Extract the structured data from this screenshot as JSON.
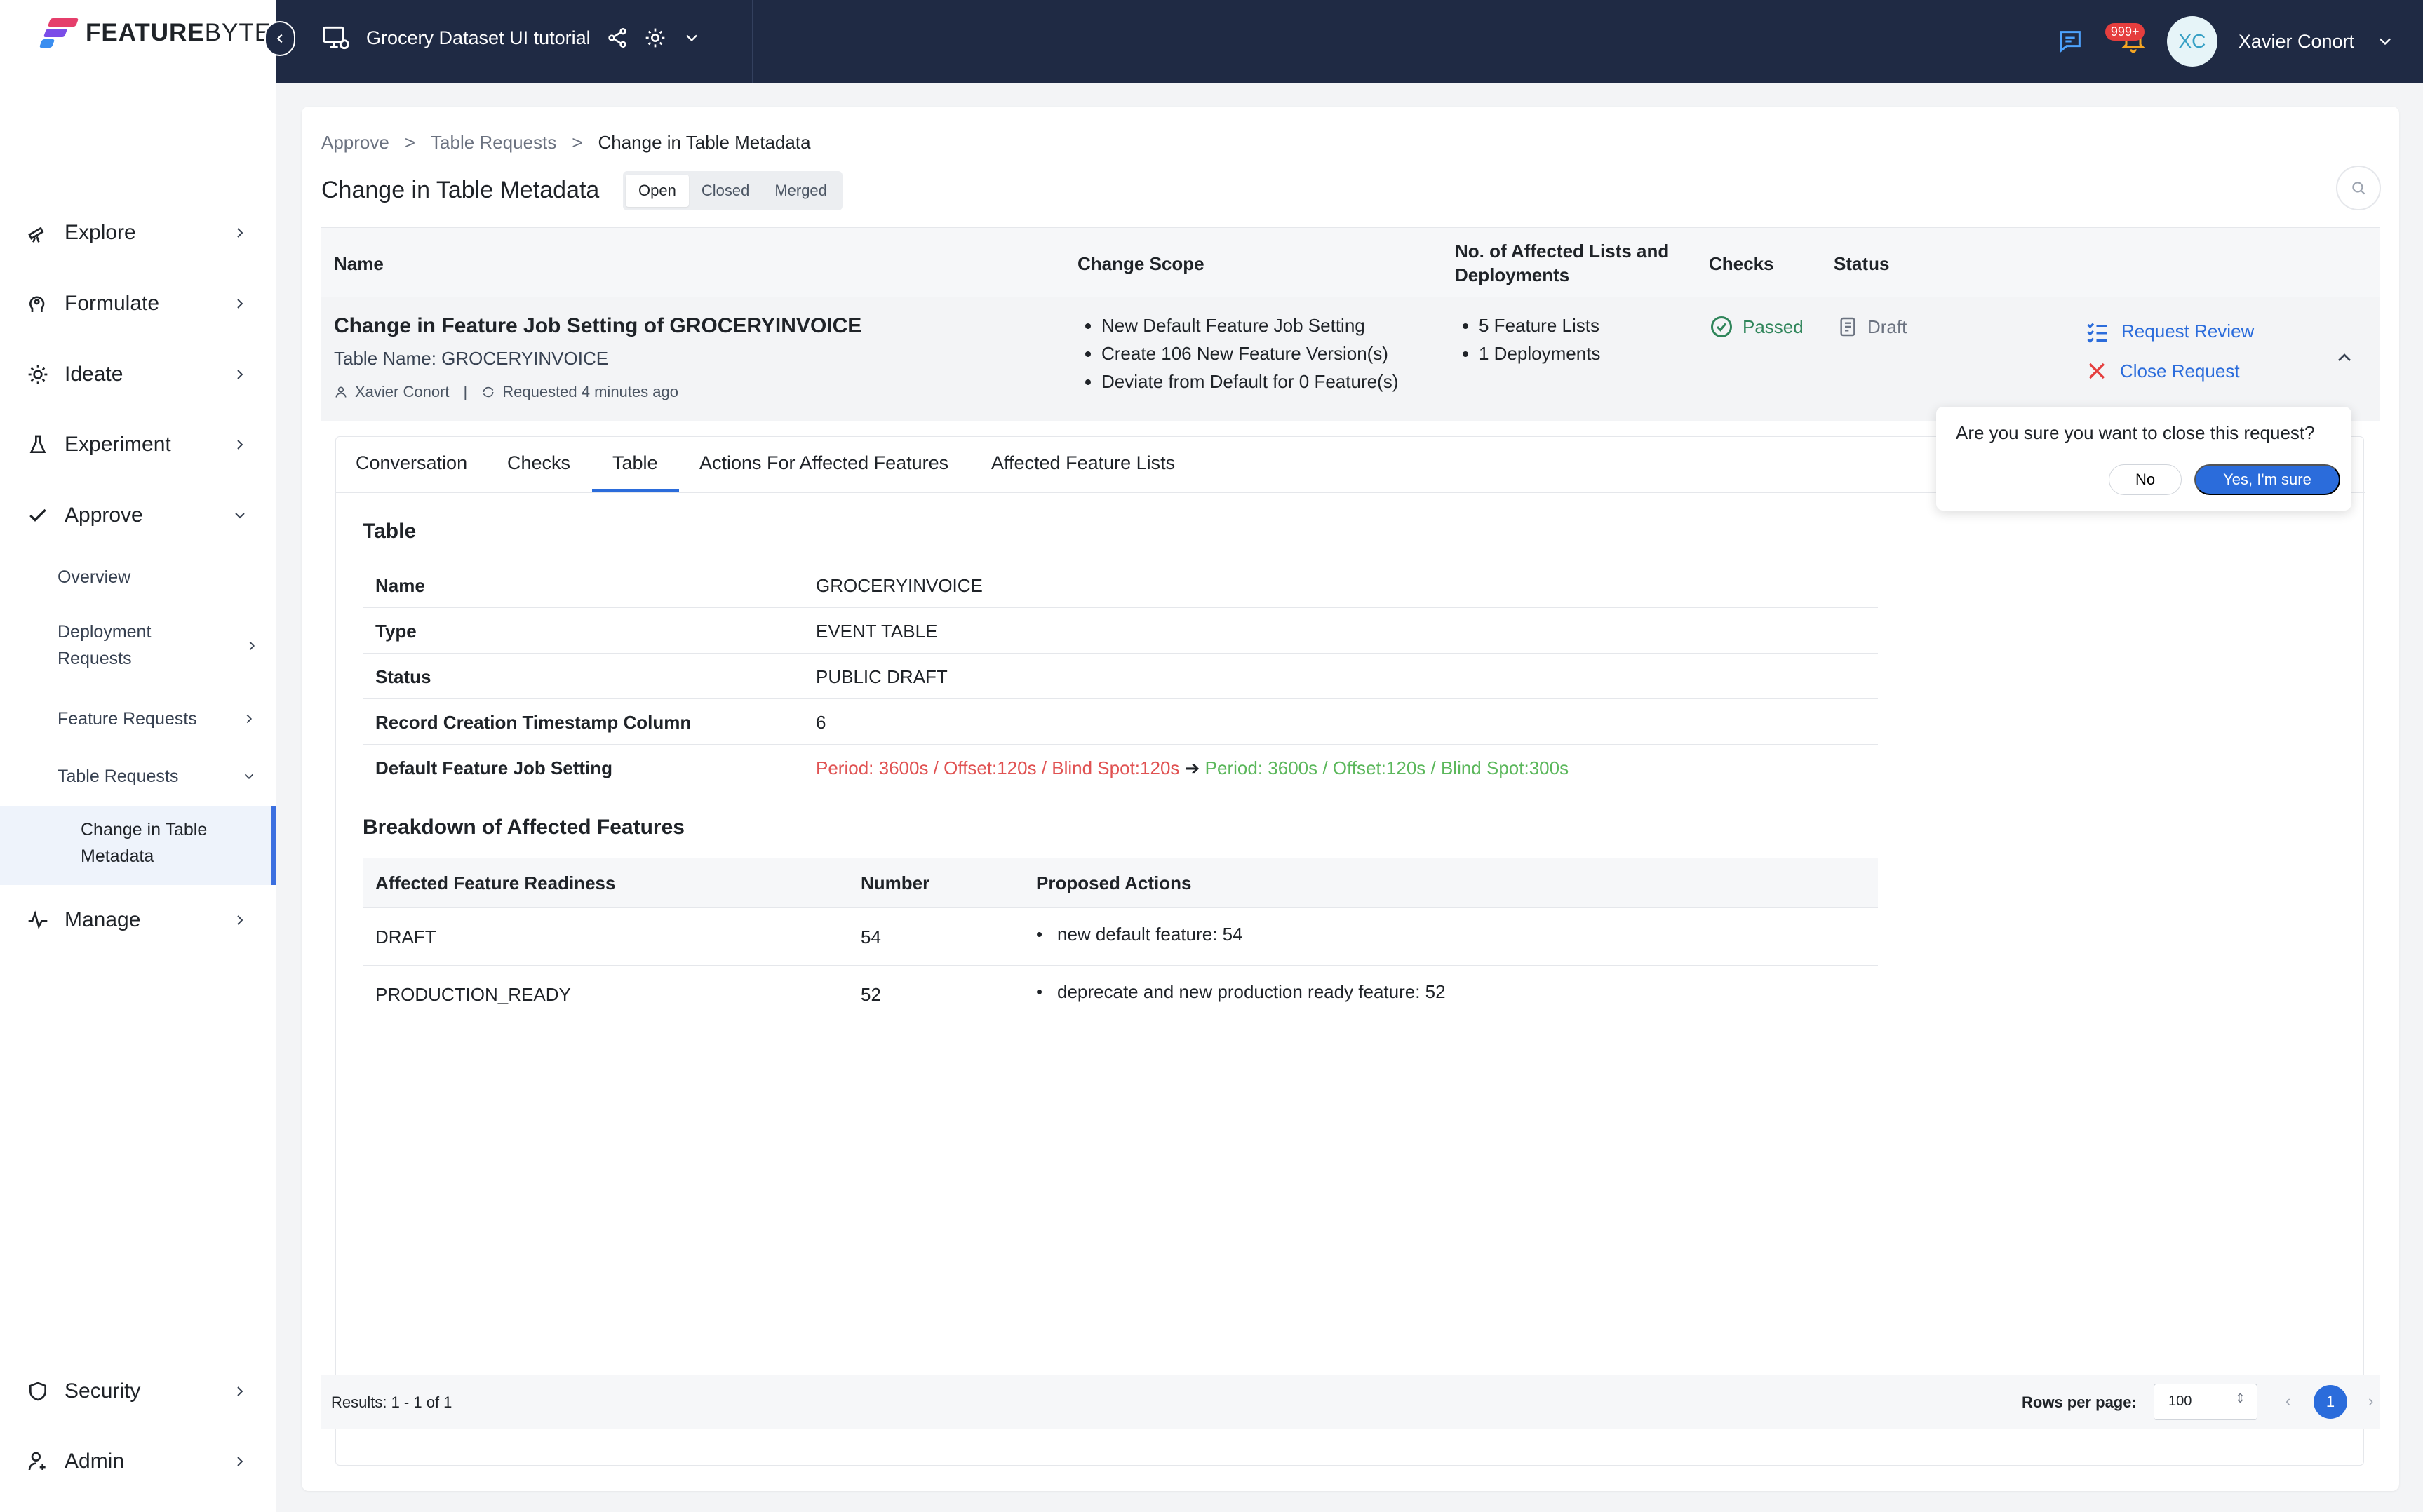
{
  "brand": {
    "name_bold": "FEATURE",
    "name_light": "BYTE",
    "colors": [
      "#e53e6b",
      "#7b4de8",
      "#3b8ef0"
    ]
  },
  "topbar": {
    "project": "Grocery Dataset UI tutorial",
    "notifications_badge": "999+",
    "user_initials": "XC",
    "user_name": "Xavier Conort"
  },
  "sidebar": {
    "items": [
      {
        "label": "Explore",
        "icon": "telescope-icon"
      },
      {
        "label": "Formulate",
        "icon": "head-icon"
      },
      {
        "label": "Ideate",
        "icon": "bulb-icon"
      },
      {
        "label": "Experiment",
        "icon": "flask-icon"
      },
      {
        "label": "Approve",
        "icon": "check-icon"
      },
      {
        "label": "Manage",
        "icon": "pulse-icon"
      },
      {
        "label": "Security",
        "icon": "shield-icon"
      },
      {
        "label": "Admin",
        "icon": "user-gear-icon"
      }
    ],
    "approve_sub": [
      "Overview",
      "Deployment Requests",
      "Feature Requests",
      "Table Requests"
    ],
    "active_leaf": "Change in Table Metadata"
  },
  "page": {
    "breadcrumbs": [
      "Approve",
      "Table Requests",
      "Change in Table Metadata"
    ],
    "title": "Change in Table Metadata",
    "filters": [
      "Open",
      "Closed",
      "Merged"
    ]
  },
  "table": {
    "headers": [
      "Name",
      "Change Scope",
      "No. of Affected Lists and Deployments",
      "Checks",
      "Status"
    ],
    "row": {
      "name": "Change in Feature Job Setting of GROCERYINVOICE",
      "table_name": "Table Name: GROCERYINVOICE",
      "author": "Xavier Conort",
      "requested": "Requested 4 minutes ago",
      "scope": [
        "New Default Feature Job Setting",
        "Create 106 New Feature Version(s)",
        "Deviate from Default for 0 Feature(s)"
      ],
      "affected": [
        "5 Feature Lists",
        "1 Deployments"
      ],
      "checks": "Passed",
      "status": "Draft",
      "actions": [
        "Request Review",
        "Close Request"
      ]
    }
  },
  "confirm": {
    "question": "Are you sure you want to close this request?",
    "no": "No",
    "yes": "Yes, I'm sure"
  },
  "detail": {
    "tabs": [
      "Conversation",
      "Checks",
      "Table",
      "Actions For Affected Features",
      "Affected Feature Lists"
    ],
    "table_section": "Table",
    "kv": [
      {
        "k": "Name",
        "v": "GROCERYINVOICE"
      },
      {
        "k": "Type",
        "v": "EVENT TABLE"
      },
      {
        "k": "Status",
        "v": "PUBLIC DRAFT"
      },
      {
        "k": "Record Creation Timestamp Column",
        "v": "6"
      },
      {
        "k": "Default Feature Job Setting",
        "old": "Period: 3600s / Offset:120s / Blind Spot:120s",
        "arrow": "➔",
        "new": "Period: 3600s / Offset:120s / Blind Spot:300s"
      }
    ],
    "breakdown_title": "Breakdown of Affected Features",
    "breakdown_headers": [
      "Affected Feature Readiness",
      "Number",
      "Proposed Actions"
    ],
    "breakdown_rows": [
      {
        "readiness": "DRAFT",
        "number": "54",
        "action": "new default feature: 54"
      },
      {
        "readiness": "PRODUCTION_READY",
        "number": "52",
        "action": "deprecate and new production ready feature: 52"
      }
    ]
  },
  "footer": {
    "results": "Results: 1 - 1 of 1",
    "rows_per_page": "Rows per page:",
    "rows_value": "100",
    "page": "1"
  }
}
